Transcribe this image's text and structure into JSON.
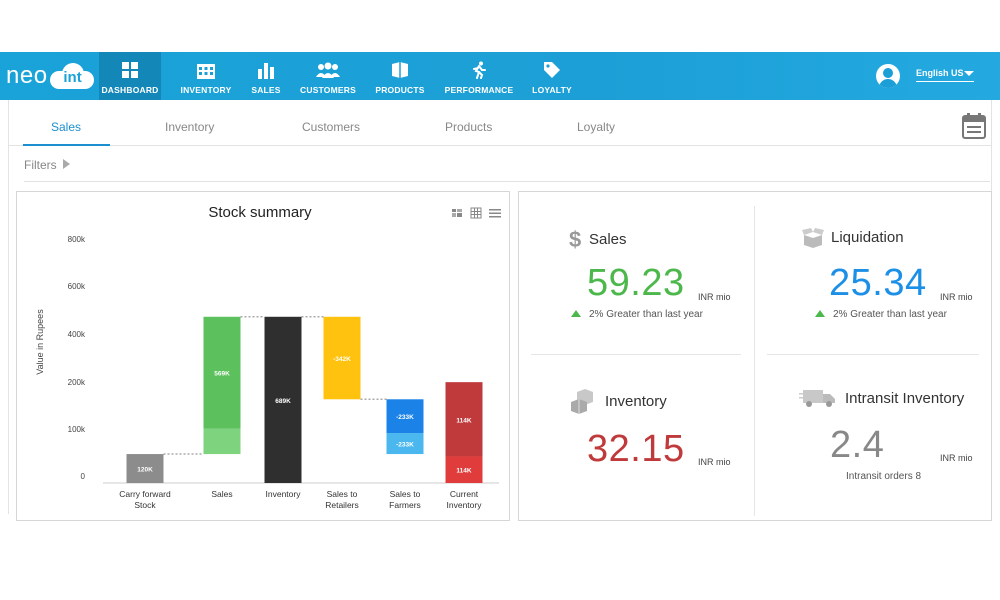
{
  "brand": {
    "logo_left": "neo",
    "logo_badge": "int"
  },
  "nav": [
    {
      "label": "DASHBOARD",
      "icon": "dashboard-icon"
    },
    {
      "label": "INVENTORY",
      "icon": "building-icon"
    },
    {
      "label": "SALES",
      "icon": "bar-chart-icon"
    },
    {
      "label": "CUSTOMERS",
      "icon": "people-icon"
    },
    {
      "label": "PRODUCTS",
      "icon": "box-icon"
    },
    {
      "label": "PERFORMANCE",
      "icon": "runner-icon"
    },
    {
      "label": "LOYALTY",
      "icon": "tag-icon"
    }
  ],
  "user": {
    "language": "English US"
  },
  "tabs": [
    "Sales",
    "Inventory",
    "Customers",
    "Products",
    "Loyalty"
  ],
  "filters_label": "Filters",
  "chart_title": "Stock summary",
  "chart_data": {
    "type": "bar",
    "subtype": "waterfall",
    "title": "Stock summary",
    "xlabel": "",
    "ylabel": "Value in Rupees",
    "ylim": [
      0,
      800000
    ],
    "yticks": [
      "0",
      "100k",
      "200k",
      "400k",
      "600k",
      "800k"
    ],
    "categories": [
      "Carry forward Stock",
      "Sales",
      "Inventory",
      "Sales to Retailers",
      "Sales to Farmers",
      "Current Inventory"
    ],
    "bars": [
      {
        "category": "Carry forward Stock",
        "segments": [
          {
            "from": 0,
            "to": 120000,
            "label": "120K",
            "color": "#8c8c8c"
          }
        ]
      },
      {
        "category": "Sales",
        "segments": [
          {
            "from": 120000,
            "to": 225000,
            "label": "",
            "color": "#7ed47e"
          },
          {
            "from": 225000,
            "to": 689000,
            "label": "569K",
            "color": "#5cc05c"
          }
        ]
      },
      {
        "category": "Inventory",
        "segments": [
          {
            "from": 0,
            "to": 689000,
            "label": "689K",
            "color": "#2f2f2f"
          }
        ]
      },
      {
        "category": "Sales to Retailers",
        "segments": [
          {
            "from": 347000,
            "to": 689000,
            "label": "-342K",
            "color": "#ffc20e"
          }
        ]
      },
      {
        "category": "Sales to Farmers",
        "segments": [
          {
            "from": 120000,
            "to": 207000,
            "label": "-233K",
            "color": "#4ab8ee"
          },
          {
            "from": 207000,
            "to": 347000,
            "label": "-233K",
            "color": "#1b82e8"
          }
        ]
      },
      {
        "category": "Current Inventory",
        "segments": [
          {
            "from": 0,
            "to": 110000,
            "label": "114K",
            "color": "#e03c3c"
          },
          {
            "from": 110000,
            "to": 418000,
            "label": "114K",
            "color": "#c0393b"
          }
        ]
      }
    ],
    "colors": {
      "grey": "#8c8c8c",
      "green": "#5cc05c",
      "black": "#2f2f2f",
      "yellow": "#ffc20e",
      "blue": "#1b82e8",
      "red": "#c0393b"
    },
    "grid": false,
    "legend": "none"
  },
  "kpis": {
    "sales": {
      "title": "Sales",
      "value": "59.23",
      "unit": "INR mio",
      "note": "2% Greater than last year",
      "color": "#4cb84c",
      "icon": "dollar-icon"
    },
    "liquidation": {
      "title": "Liquidation",
      "value": "25.34",
      "unit": "INR mio",
      "note": "2% Greater than last year",
      "color": "#1c8fe6",
      "icon": "open-box-icon"
    },
    "inventory": {
      "title": "Inventory",
      "value": "32.15",
      "unit": "INR mio",
      "color": "#c0393b",
      "icon": "boxes-icon"
    },
    "intransit": {
      "title": "Intransit Inventory",
      "value": "2.4",
      "unit": "INR mio",
      "note": "Intransit orders 8",
      "color": "#888888",
      "icon": "truck-icon"
    }
  }
}
